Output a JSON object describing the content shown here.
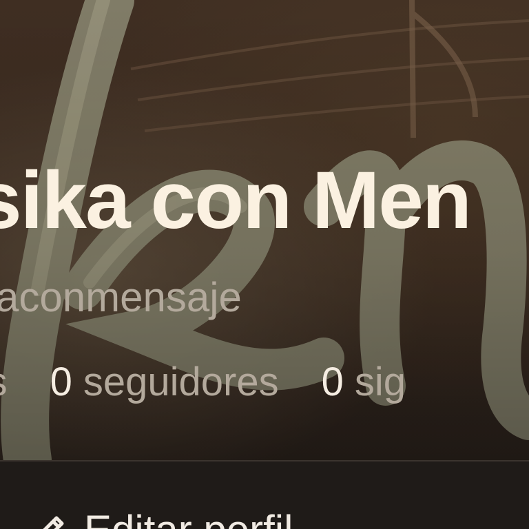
{
  "profile": {
    "name": "sika con Men",
    "handle": "caconmensaje"
  },
  "stats": [
    {
      "count": "",
      "label": "ras"
    },
    {
      "count": "0",
      "label": "seguidores"
    },
    {
      "count": "0",
      "label": "sig"
    }
  ],
  "actions": {
    "edit_label": "Editar perfil",
    "edit_icon": "pencil-icon"
  },
  "colors": {
    "title": "#fbf1e1",
    "muted": "#b3a99c",
    "cover_bg": "#3a2a1f",
    "bar_bg": "#1f1b18"
  }
}
